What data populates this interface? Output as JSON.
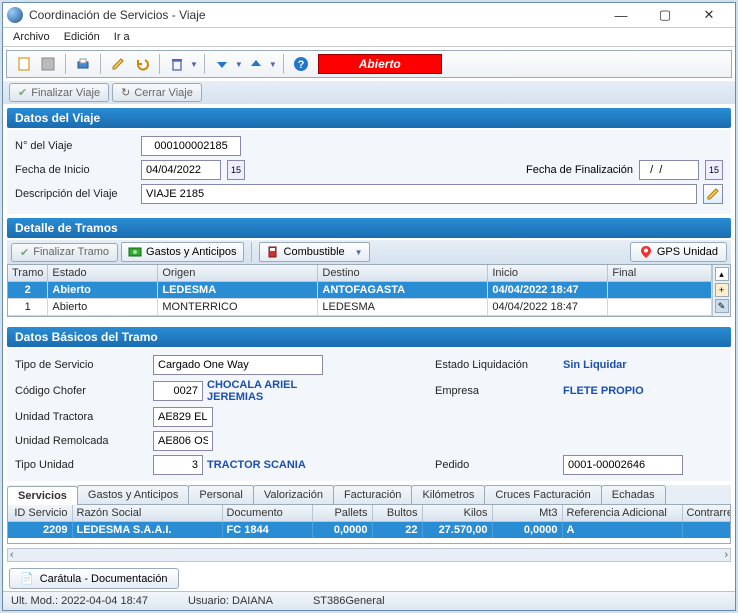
{
  "window": {
    "title": "Coordinación de Servicios - Viaje"
  },
  "menu": {
    "archivo": "Archivo",
    "edicion": "Edición",
    "ira": "Ir a"
  },
  "toolbar": {
    "status_label": "Abierto"
  },
  "ribbon": {
    "finalizar_viaje": "Finalizar Viaje",
    "cerrar_viaje": "Cerrar Viaje"
  },
  "sec_datos_viaje": "Datos del Viaje",
  "viaje": {
    "num_label": "N° del Viaje",
    "num_value": "000100002185",
    "inicio_label": "Fecha de Inicio",
    "inicio_value": "04/04/2022",
    "fin_label": "Fecha de Finalización",
    "fin_value": "  /  /",
    "desc_label": "Descripción del Viaje",
    "desc_value": "VIAJE 2185"
  },
  "sec_detalle_tramos": "Detalle de Tramos",
  "tramo_toolbar": {
    "finalizar_tramo": "Finalizar Tramo",
    "gastos": "Gastos y Anticipos",
    "combustible": "Combustible",
    "gps": "GPS Unidad"
  },
  "tramo_cols": {
    "tramo": "Tramo",
    "estado": "Estado",
    "origen": "Origen",
    "destino": "Destino",
    "inicio": "Inicio",
    "final": "Final"
  },
  "tramos": [
    {
      "n": "2",
      "estado": "Abierto",
      "origen": "LEDESMA",
      "destino": "ANTOFAGASTA",
      "inicio": "04/04/2022 18:47",
      "final": ""
    },
    {
      "n": "1",
      "estado": "Abierto",
      "origen": "MONTERRICO",
      "destino": "LEDESMA",
      "inicio": "04/04/2022 18:47",
      "final": ""
    }
  ],
  "sec_basicos": "Datos Básicos del Tramo",
  "basicos": {
    "tipo_serv_label": "Tipo de Servicio",
    "tipo_serv_value": "Cargado One Way",
    "estado_liq_label": "Estado Liquidación",
    "estado_liq_value": "Sin Liquidar",
    "chofer_label": "Código Chofer",
    "chofer_code": "0027",
    "chofer_name": "CHOCALA ARIEL JEREMIAS",
    "empresa_label": "Empresa",
    "empresa_value": "FLETE PROPIO",
    "tractora_label": "Unidad Tractora",
    "tractora_value": "AE829 EL",
    "remolcada_label": "Unidad Remolcada",
    "remolcada_value": "AE806 OS",
    "tipo_unidad_label": "Tipo Unidad",
    "tipo_unidad_code": "3",
    "tipo_unidad_name": "TRACTOR SCANIA",
    "pedido_label": "Pedido",
    "pedido_value": "0001-00002646"
  },
  "tabs": {
    "servicios": "Servicios",
    "gastos": "Gastos y Anticipos",
    "personal": "Personal",
    "valorizacion": "Valorización",
    "facturacion": "Facturación",
    "km": "Kilómetros",
    "cruces": "Cruces Facturación",
    "echadas": "Echadas"
  },
  "serv_cols": {
    "id": "ID Servicio",
    "razon": "Razón Social",
    "doc": "Documento",
    "pallets": "Pallets",
    "bultos": "Bultos",
    "kilos": "Kilos",
    "mt3": "Mt3",
    "ref": "Referencia Adicional",
    "contra": "Contrarremb"
  },
  "servicios": [
    {
      "id": "2209",
      "razon": "LEDESMA S.A.A.I.",
      "doc": "FC 1844",
      "pallets": "0,0000",
      "bultos": "22",
      "kilos": "27.570,00",
      "mt3": "0,0000",
      "ref": "A",
      "contra": ""
    }
  ],
  "caratula": "Carátula - Documentación",
  "status": {
    "mod": "Ult. Mod.: 2022-04-04 18:47",
    "user": "Usuario: DAIANA",
    "misc": "ST386General"
  }
}
